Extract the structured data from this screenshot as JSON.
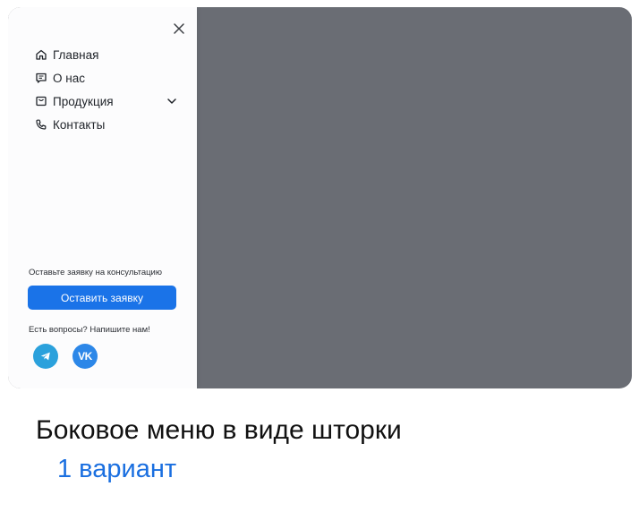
{
  "nav": {
    "items": [
      {
        "label": "Главная",
        "icon": "home-icon"
      },
      {
        "label": "О нас",
        "icon": "message-icon"
      },
      {
        "label": "Продукция",
        "icon": "box-icon",
        "has_submenu": true
      },
      {
        "label": "Контакты",
        "icon": "phone-icon"
      }
    ]
  },
  "cta": {
    "prompt": "Оставьте заявку на консультацию",
    "button_label": "Оставить заявку"
  },
  "contact": {
    "prompt": "Есть вопросы? Напишите нам!",
    "social": [
      "telegram-icon",
      "vk-icon"
    ],
    "vk_text": "VK"
  },
  "caption": {
    "title": "Боковое меню в виде шторки",
    "variant": "1 вариант"
  },
  "colors": {
    "accent": "#1a73e8",
    "overlay": "#6a6d74",
    "telegram": "#2ba1dc",
    "vk": "#2c87e8",
    "variant_text": "#1a6fe0"
  }
}
